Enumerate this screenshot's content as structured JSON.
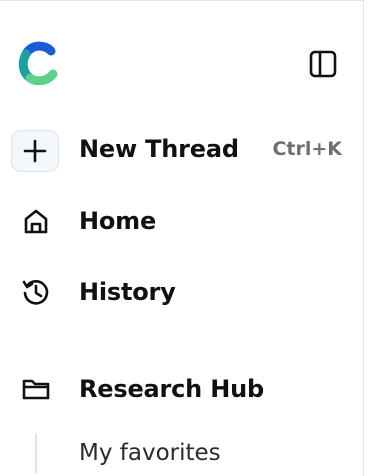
{
  "sidebar": {
    "brand": {
      "icon": "c-logo-icon"
    },
    "toggle": {
      "icon": "sidebar-toggle-icon"
    },
    "nav": [
      {
        "label": "New Thread",
        "icon": "plus-icon",
        "shortcut": "Ctrl+K"
      },
      {
        "label": "Home",
        "icon": "home-icon"
      },
      {
        "label": "History",
        "icon": "history-icon"
      }
    ],
    "section": {
      "label": "Research Hub",
      "icon": "folder-icon"
    },
    "subitems": [
      {
        "label": "My favorites"
      }
    ],
    "colors": {
      "logo_teal": "#1f9f9f",
      "logo_blue": "#1a5bd8",
      "logo_green": "#5fd08b"
    }
  }
}
